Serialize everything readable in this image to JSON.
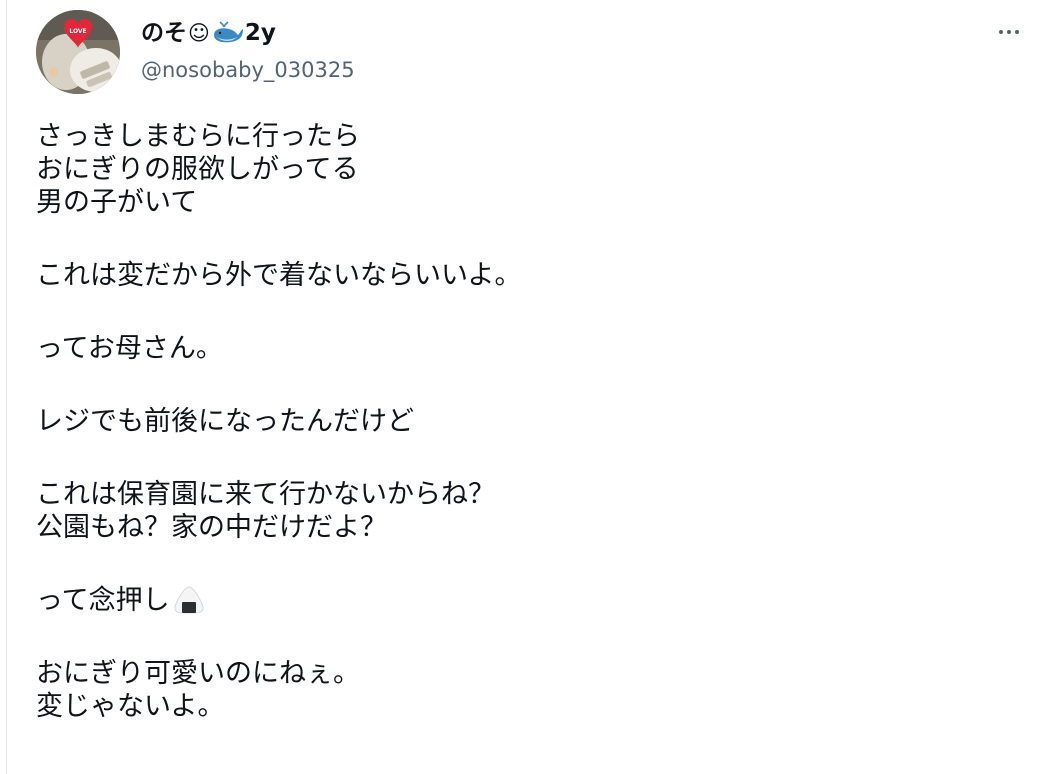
{
  "tweet": {
    "author": {
      "display_name_start": "のそ",
      "display_name_smiley": "☺",
      "display_name_end": "2y",
      "handle": "@nosobaby_030325",
      "avatar_sticker_text": "LOVE"
    },
    "more_icon": "more-horizontal-icon",
    "paragraphs": [
      [
        "さっきしまむらに行ったら",
        "おにぎりの服欲しがってる",
        "男の子がいて"
      ],
      [
        "これは変だから外で着ないならいいよ。"
      ],
      [
        "ってお母さん。"
      ],
      [
        "レジでも前後になったんだけど"
      ],
      [
        "これは保育園に来て行かないからね？",
        "公園もね？家の中だけだよ？"
      ],
      [
        "って念押し"
      ],
      [
        "おにぎり可愛いのにねぇ。",
        "変じゃないよ。"
      ]
    ],
    "emojis": {
      "name": "whale-icon",
      "after_nenoshi": "onigiri-icon"
    }
  }
}
